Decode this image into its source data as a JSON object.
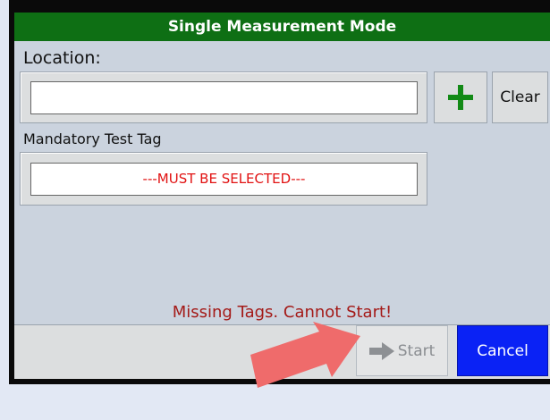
{
  "window": {
    "title": "Single Measurement Mode"
  },
  "location": {
    "label": "Location:",
    "value": "",
    "add_icon": "plus-icon",
    "clear_label": "Clear"
  },
  "tag": {
    "label": "Mandatory Test Tag",
    "value": "---MUST BE SELECTED---"
  },
  "status": {
    "message": "Missing Tags. Cannot Start!"
  },
  "actions": {
    "start_label": "Start",
    "start_icon": "arrow-right-icon",
    "cancel_label": "Cancel"
  },
  "colors": {
    "title_bar": "#0e6f14",
    "add_plus": "#128a16",
    "required_text": "#e11212",
    "error_text": "#a41a18",
    "cancel_button": "#0a22f5",
    "annotation_arrow": "#ef6b6b"
  },
  "annotation": {
    "icon": "pointer-arrow-icon"
  }
}
